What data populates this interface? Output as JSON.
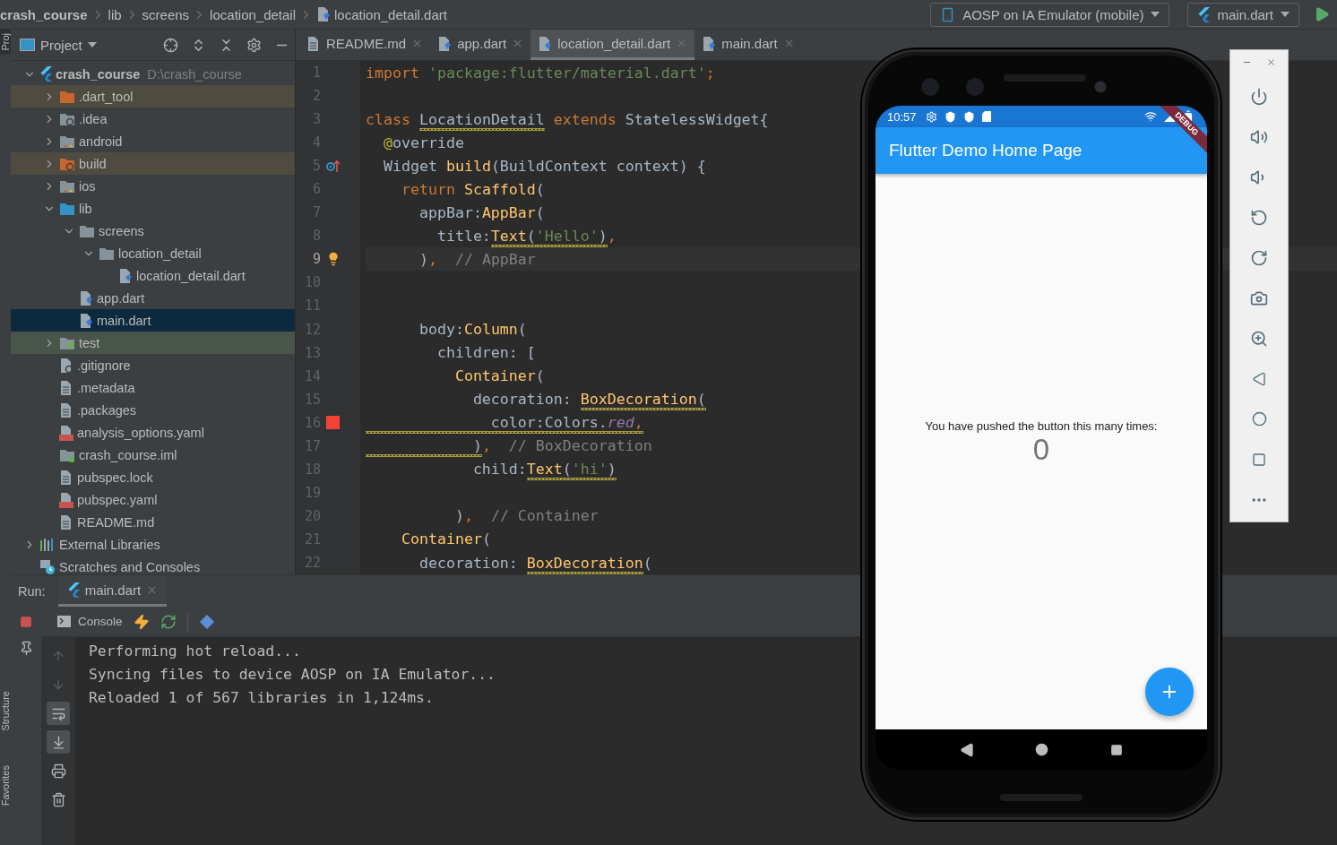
{
  "breadcrumbs": [
    {
      "label": "crash_course",
      "kind": "project"
    },
    {
      "label": "lib",
      "kind": "folder"
    },
    {
      "label": "screens",
      "kind": "folder"
    },
    {
      "label": "location_detail",
      "kind": "folder"
    },
    {
      "label": "location_detail.dart",
      "kind": "dart"
    }
  ],
  "run_config": {
    "device": "AOSP on IA Emulator (mobile)",
    "target": "main.dart"
  },
  "side_tabs": {
    "top": [
      {
        "label": "Proj",
        "selected": true
      }
    ],
    "bottom": [
      {
        "label": "Structure",
        "selected": false
      },
      {
        "label": "Favorites",
        "selected": false
      }
    ]
  },
  "project_panel": {
    "title": "Project"
  },
  "tree": [
    {
      "label": "crash_course",
      "kind": "project",
      "hint": "D:\\crash_course",
      "expanded": true,
      "selected": false,
      "children": [
        {
          "label": ".dart_tool",
          "kind": "folder",
          "excluded": true,
          "expanded": false,
          "selected": false
        },
        {
          "label": ".idea",
          "kind": "folder-config",
          "expanded": false,
          "selected": false
        },
        {
          "label": "android",
          "kind": "folder-module",
          "expanded": false,
          "selected": false
        },
        {
          "label": "build",
          "kind": "folder-config",
          "excluded": true,
          "expanded": false,
          "selected": false
        },
        {
          "label": "ios",
          "kind": "folder-module",
          "expanded": false,
          "selected": false
        },
        {
          "label": "lib",
          "kind": "folder-source",
          "expanded": true,
          "selected": false,
          "children": [
            {
              "label": "screens",
              "kind": "folder",
              "expanded": true,
              "selected": false,
              "children": [
                {
                  "label": "location_detail",
                  "kind": "folder",
                  "expanded": true,
                  "selected": false,
                  "children": [
                    {
                      "label": "location_detail.dart",
                      "kind": "dart",
                      "selected": false
                    }
                  ]
                }
              ]
            },
            {
              "label": "app.dart",
              "kind": "dart",
              "selected": false
            },
            {
              "label": "main.dart",
              "kind": "dart",
              "selected": true
            }
          ]
        },
        {
          "label": "test",
          "kind": "folder-test",
          "test_root": true,
          "expanded": false,
          "selected": false
        },
        {
          "label": ".gitignore",
          "kind": "ignore",
          "selected": false
        },
        {
          "label": ".metadata",
          "kind": "text",
          "selected": false
        },
        {
          "label": ".packages",
          "kind": "text",
          "selected": false
        },
        {
          "label": "analysis_options.yaml",
          "kind": "yaml",
          "selected": false
        },
        {
          "label": "crash_course.iml",
          "kind": "module-file",
          "selected": false
        },
        {
          "label": "pubspec.lock",
          "kind": "text",
          "selected": false
        },
        {
          "label": "pubspec.yaml",
          "kind": "yaml",
          "selected": false
        },
        {
          "label": "README.md",
          "kind": "text",
          "selected": false
        }
      ]
    },
    {
      "label": "External Libraries",
      "kind": "libraries",
      "expanded": false,
      "selected": false
    },
    {
      "label": "Scratches and Consoles",
      "kind": "scratches",
      "selected": false
    }
  ],
  "editor_tabs": [
    {
      "label": "README.md",
      "kind": "text",
      "selected": false
    },
    {
      "label": "app.dart",
      "kind": "dart",
      "selected": false
    },
    {
      "label": "location_detail.dart",
      "kind": "dart",
      "selected": true
    },
    {
      "label": "main.dart",
      "kind": "dart",
      "selected": false
    }
  ],
  "code_lines": [
    {
      "number": "1",
      "kind": "plain",
      "current": false,
      "tokens": [
        {
          "text": "import ",
          "kind": "k"
        },
        {
          "text": "'package:flutter/material.dart'",
          "kind": "s"
        },
        {
          "text": ";",
          "kind": "k"
        }
      ]
    },
    {
      "number": "2",
      "kind": "plain",
      "current": false
    },
    {
      "number": "3",
      "kind": "plain",
      "current": false,
      "tokens": [
        {
          "text": "class ",
          "kind": "k"
        },
        {
          "text": "LocationDetail",
          "kind": "p",
          "warn": true
        },
        {
          "text": " extends ",
          "kind": "k"
        },
        {
          "text": "StatelessWidget{",
          "kind": "p"
        }
      ]
    },
    {
      "number": "4",
      "kind": "plain",
      "current": false,
      "tokens": [
        {
          "text": "  @",
          "kind": "a"
        },
        {
          "text": "override",
          "kind": "p"
        }
      ]
    },
    {
      "number": "5",
      "kind": "override",
      "current": false,
      "tokens": [
        {
          "text": "  Widget ",
          "kind": "p"
        },
        {
          "text": "build",
          "kind": "f"
        },
        {
          "text": "(BuildContext context) {",
          "kind": "p"
        }
      ]
    },
    {
      "number": "6",
      "kind": "plain",
      "current": false,
      "tokens": [
        {
          "text": "    return ",
          "kind": "k"
        },
        {
          "text": "Scaffold",
          "kind": "f"
        },
        {
          "text": "(",
          "kind": "p"
        }
      ]
    },
    {
      "number": "7",
      "kind": "plain",
      "current": false,
      "tokens": [
        {
          "text": "      appBar:",
          "kind": "p"
        },
        {
          "text": "AppBar",
          "kind": "f"
        },
        {
          "text": "(",
          "kind": "p"
        }
      ]
    },
    {
      "number": "8",
      "kind": "plain",
      "current": false,
      "tokens": [
        {
          "text": "        title:",
          "kind": "p"
        },
        {
          "text": "Text",
          "kind": "f",
          "warn": true
        },
        {
          "text": "(",
          "kind": "p",
          "warn": true
        },
        {
          "text": "'Hello'",
          "kind": "s",
          "warn": true
        },
        {
          "text": ")",
          "kind": "p",
          "warn": true
        },
        {
          "text": ",",
          "kind": "k"
        }
      ]
    },
    {
      "number": "9",
      "kind": "bulb",
      "current": true,
      "tokens": [
        {
          "text": "      )",
          "kind": "p"
        },
        {
          "text": ",",
          "kind": "k"
        },
        {
          "text": "  // AppBar",
          "kind": "c"
        }
      ]
    },
    {
      "number": "10",
      "kind": "plain",
      "current": false
    },
    {
      "number": "11",
      "kind": "plain",
      "current": false
    },
    {
      "number": "12",
      "kind": "plain",
      "current": false,
      "tokens": [
        {
          "text": "      body:",
          "kind": "p"
        },
        {
          "text": "Column",
          "kind": "f"
        },
        {
          "text": "(",
          "kind": "p"
        }
      ]
    },
    {
      "number": "13",
      "kind": "plain",
      "current": false,
      "tokens": [
        {
          "text": "        children: [",
          "kind": "p"
        }
      ]
    },
    {
      "number": "14",
      "kind": "plain",
      "current": false,
      "tokens": [
        {
          "text": "          Container",
          "kind": "f"
        },
        {
          "text": "(",
          "kind": "p"
        }
      ]
    },
    {
      "number": "15",
      "kind": "plain",
      "current": false,
      "tokens": [
        {
          "text": "            decoration: ",
          "kind": "p"
        },
        {
          "text": "BoxDecoration",
          "kind": "f",
          "warn": true
        },
        {
          "text": "(",
          "kind": "p",
          "warn": true
        }
      ]
    },
    {
      "number": "16",
      "kind": "swatch",
      "current": false,
      "tokens": [
        {
          "text": "              color:Colors.",
          "kind": "p",
          "warn": true
        },
        {
          "text": "red",
          "kind": "i",
          "warn": true
        },
        {
          "text": ",",
          "kind": "k",
          "warn": true
        }
      ]
    },
    {
      "number": "17",
      "kind": "plain",
      "current": false,
      "tokens": [
        {
          "text": "            )",
          "kind": "p",
          "warn": true
        },
        {
          "text": ",",
          "kind": "k"
        },
        {
          "text": "  // BoxDecoration",
          "kind": "c"
        }
      ]
    },
    {
      "number": "18",
      "kind": "plain",
      "current": false,
      "tokens": [
        {
          "text": "            child:",
          "kind": "p"
        },
        {
          "text": "Text",
          "kind": "f",
          "warn": true
        },
        {
          "text": "(",
          "kind": "p",
          "warn": true
        },
        {
          "text": "'hi'",
          "kind": "s",
          "warn": true
        },
        {
          "text": ")",
          "kind": "p",
          "warn": true
        }
      ]
    },
    {
      "number": "19",
      "kind": "plain",
      "current": false
    },
    {
      "number": "20",
      "kind": "plain",
      "current": false,
      "tokens": [
        {
          "text": "          )",
          "kind": "p"
        },
        {
          "text": ",",
          "kind": "k"
        },
        {
          "text": "  // Container",
          "kind": "c"
        }
      ]
    },
    {
      "number": "21",
      "kind": "plain",
      "current": false,
      "tokens": [
        {
          "text": "    Container",
          "kind": "f"
        },
        {
          "text": "(",
          "kind": "p"
        }
      ]
    },
    {
      "number": "22",
      "kind": "plain",
      "current": false,
      "tokens": [
        {
          "text": "      decoration: ",
          "kind": "p"
        },
        {
          "text": "BoxDecoration",
          "kind": "f",
          "warn": true
        },
        {
          "text": "(",
          "kind": "p"
        }
      ]
    }
  ],
  "run_panel": {
    "label": "Run:",
    "tabs": [
      {
        "label": "main.dart",
        "selected": true
      }
    ],
    "console_tab": "Console",
    "lines": [
      "Performing hot reload...",
      "Syncing files to device AOSP on IA Emulator...",
      "Reloaded 1 of 567 libraries in 1,124ms."
    ]
  },
  "phone": {
    "time": "10:57",
    "banner": "DEBUG",
    "app_title": "Flutter Demo Home Page",
    "message": "You have pushed the button this many times:",
    "counter": "0"
  }
}
